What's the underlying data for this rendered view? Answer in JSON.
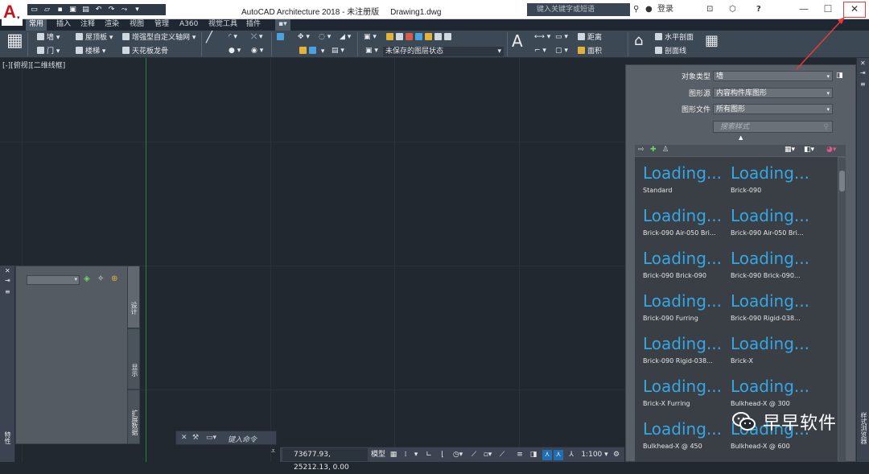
{
  "titlebar": {
    "title": "AutoCAD Architecture 2018 - 未注册版     Drawing1.dwg",
    "search_placeholder": "键入关键字或短语",
    "login": "登录",
    "help": "?"
  },
  "ribbon": {
    "tabs": [
      "常用",
      "插入",
      "注释",
      "渲染",
      "视图",
      "管理",
      "A360",
      "视觉工具",
      "插件"
    ],
    "active_tab": "常用",
    "items": {
      "wall": "墙",
      "door": "门",
      "roof_slab": "屋顶板",
      "stair": "楼梯",
      "enhanced_grid": "增强型自定义轴网",
      "ceiling_grid": "天花板龙骨",
      "layer_state": "未保存的图层状态",
      "distance": "距离",
      "area": "面积",
      "horizontal_section": "水平剖面",
      "section_line": "剖面线"
    }
  },
  "canvas": {
    "view_label": "[-][俯视][二维线框]"
  },
  "left_palette": {
    "tabs": [
      "设计",
      "显示",
      "扩展数据"
    ],
    "strip_label": "特性"
  },
  "command_line": {
    "placeholder": "键入命令"
  },
  "status_bar": {
    "coords": "73677.93, 25212.13, 0.00",
    "model": "模型",
    "scale": "1:100"
  },
  "right_palette": {
    "labels": {
      "object_type": "对象类型",
      "drawing_source": "图形源",
      "drawing_file": "图形文件"
    },
    "values": {
      "object_type": "墙",
      "drawing_source": "内容构件库图形",
      "drawing_file": "所有图形"
    },
    "search_placeholder": "搜索样式",
    "side_label": "样式浏览器",
    "loading_text": "Loading...",
    "styles": [
      "Standard",
      "Brick-090",
      "Brick-090 Air-050 Bri...",
      "Brick-090 Air-050 Bri...",
      "Brick-090 Brick-090",
      "Brick-090 Brick-090...",
      "Brick-090 Furring",
      "Brick-090 Rigid-038...",
      "Brick-090 Rigid-038...",
      "Brick-X",
      "Brick-X Furring",
      "Bulkhead-X @ 300",
      "Bulkhead-X @ 450",
      "Bulkhead-X @ 600"
    ]
  },
  "watermark": {
    "text": "早早软件"
  },
  "colors": {
    "loading": "#35a7e4",
    "canvas": "#212830",
    "annotation_red": "#e53b3b"
  }
}
